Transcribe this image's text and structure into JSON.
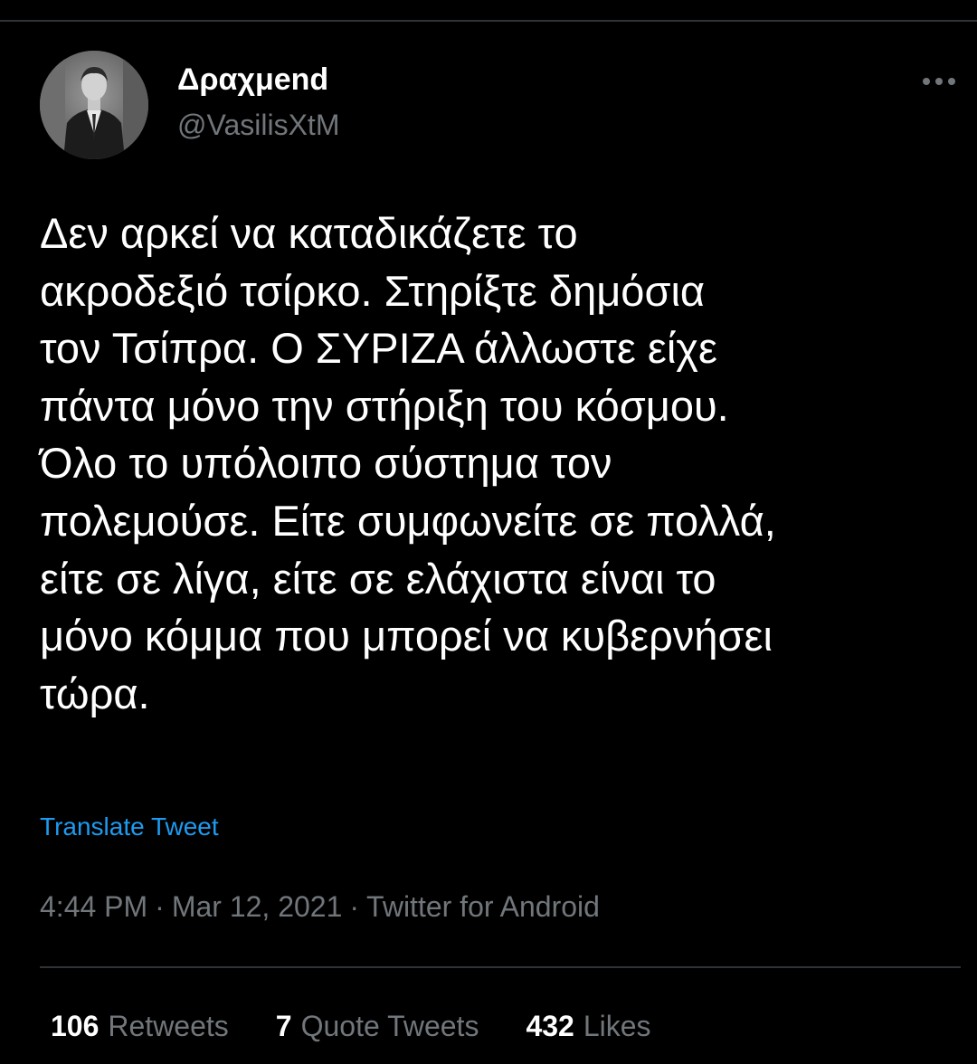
{
  "author": {
    "display_name": "Δραχμend",
    "handle": "@VasilisXtM",
    "avatar_icon": "profile-photo"
  },
  "more_icon": "ellipsis-icon",
  "tweet": {
    "lines": [
      "Δεν αρκεί να καταδικάζετε το",
      "ακροδεξιό τσίρκο. Στηρίξτε δημόσια",
      "τον Τσίπρα. Ο ΣΥΡΙΖΑ άλλωστε είχε",
      "πάντα μόνο την στήριξη του κόσμου.",
      "Όλο το υπόλοιπο σύστημα τον",
      "πολεμούσε. Είτε συμφωνείτε σε πολλά,",
      "είτε σε λίγα, είτε σε ελάχιστα είναι το",
      "μόνο κόμμα που μπορεί να κυβερνήσει",
      "τώρα."
    ],
    "translate_label": "Translate Tweet"
  },
  "meta": {
    "time": "4:44 PM",
    "separator": "·",
    "date": "Mar 12, 2021",
    "source": "Twitter for Android"
  },
  "stats": {
    "retweets_count": "106",
    "retweets_label": "Retweets",
    "quotes_count": "7",
    "quotes_label": "Quote Tweets",
    "likes_count": "432",
    "likes_label": "Likes"
  },
  "colors": {
    "background": "#000000",
    "text_primary": "#ffffff",
    "text_secondary": "#71767b",
    "link": "#1d9bf0",
    "divider": "#2f3336"
  }
}
